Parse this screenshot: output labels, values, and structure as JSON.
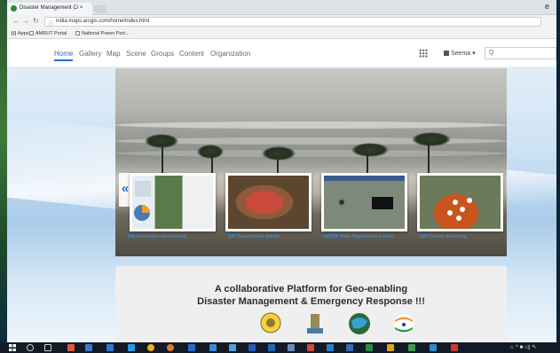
{
  "browser": {
    "tab_title": "Disaster Management Ci ×",
    "tab_close": "×",
    "address": "india.maps.arcgis.com/home/index.html",
    "bookmarks": [
      "Apps",
      "AMRUT Portal",
      "National Power Port..."
    ],
    "window_control": "e"
  },
  "portal_nav": {
    "links": [
      "Home",
      "Gallery",
      "Map",
      "Scene",
      "Groups",
      "Content",
      "Organization"
    ],
    "active": "Home",
    "user_name": "Seema ▾",
    "search_placeholder": "Q"
  },
  "gallery": {
    "items": [
      {
        "label": "DM   Executive Dashboard"
      },
      {
        "label": "DM Department Portal"
      },
      {
        "label": "NDMA   Web Application Leads"
      },
      {
        "label": "DM   Crowd Sourcing"
      }
    ],
    "prev_symbol": "«",
    "next_symbol": "»"
  },
  "tagline": {
    "line1": "A collaborative Platform for Geo-enabling",
    "line2": "Disaster Management & Emergency Response !!!"
  },
  "taskbar": {
    "tray_text": "☼ ^ ■ ◁) ✎"
  },
  "colors": {
    "accent_blue": "#2b6ec8",
    "thumb_label_blue": "#3a8ad6",
    "taskbar": "#121a26"
  }
}
